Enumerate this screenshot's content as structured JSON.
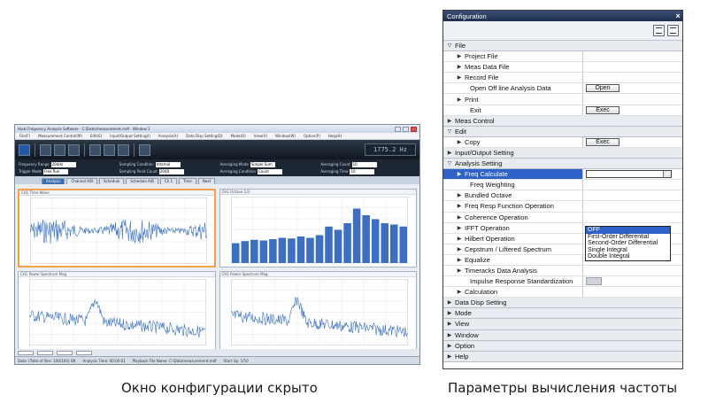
{
  "left_window": {
    "title": "Hioki Frequency Analysis Software - C:\\Data\\measurement.mdf - Window 1",
    "menu": [
      "File(F)",
      "Measurement Control(M)",
      "Edit(E)",
      "Input/Output Setting(I)",
      "Analysis(A)",
      "Data Disp Setting(D)",
      "Mode(O)",
      "View(V)",
      "Window(W)",
      "Option(P)",
      "Help(H)"
    ],
    "lcd": "1775.2 Hz",
    "params": [
      {
        "label": "Frequency Range",
        "value": "20kHz"
      },
      {
        "label": "Sampling Condition",
        "value": "Internal"
      },
      {
        "label": "Averaging Mode",
        "value": "Simple Sum"
      },
      {
        "label": "Averaging Count",
        "value": "10"
      },
      {
        "label": "Trigger Mode",
        "value": "Free Run"
      },
      {
        "label": "Sampling Point Count",
        "value": "2048"
      },
      {
        "label": "Averaging Condition",
        "value": "Count"
      },
      {
        "label": "Averaging Time",
        "value": "10"
      }
    ],
    "tabs": [
      "Analysis",
      "Channel A/B",
      "Schedule",
      "Schedule A/B",
      "Ch 1",
      "Time",
      "Next"
    ],
    "plots": [
      {
        "title": "CH1 Time Wave",
        "footer": "X: 0.000s  Y: 0.0000 mV"
      },
      {
        "title": "CH1 Octave 1/3",
        "footer": "X: 20.000 kHz  Y: 40.0000 dB"
      },
      {
        "title": "CH1 Power Spectrum Mag",
        "footer": "X: 0.000kHz  Y: 10.0000 dBV"
      },
      {
        "title": "CH1 Power Spectrum Mag",
        "footer": "X: 0.000kHz  Y: 10.0000 dBV"
      }
    ],
    "status": [
      "Data: (Total of files: 100/100)  OK",
      "Analysis Time: 00:00:01",
      "Playback File Name: C:\\Data\\measurement.mdf",
      "Start Up: 1/10"
    ]
  },
  "config": {
    "title": "Configuration",
    "close": "×",
    "rows": [
      {
        "type": "cat",
        "arrow": "▽",
        "label": "File",
        "indent": 0
      },
      {
        "type": "item",
        "arrow": "▶",
        "label": "Project File",
        "indent": 1
      },
      {
        "type": "item",
        "arrow": "▶",
        "label": "Meas Data File",
        "indent": 1
      },
      {
        "type": "item",
        "arrow": "▶",
        "label": "Record File",
        "indent": 1
      },
      {
        "type": "item",
        "arrow": "",
        "label": "Open Off line Analysis Data",
        "indent": 1,
        "button": "Open"
      },
      {
        "type": "item",
        "arrow": "▶",
        "label": "Print",
        "indent": 1
      },
      {
        "type": "item",
        "arrow": "",
        "label": "Exit",
        "indent": 1,
        "button": "Exec"
      },
      {
        "type": "cat",
        "arrow": "▶",
        "label": "Meas Control",
        "indent": 0
      },
      {
        "type": "cat",
        "arrow": "▽",
        "label": "Edit",
        "indent": 0
      },
      {
        "type": "item",
        "arrow": "▶",
        "label": "Copy",
        "indent": 1,
        "button": "Exec"
      },
      {
        "type": "cat",
        "arrow": "▶",
        "label": "Input/Output Setting",
        "indent": 0
      },
      {
        "type": "cat",
        "arrow": "▽",
        "label": "Analysis Setting",
        "indent": 0
      },
      {
        "type": "hl",
        "arrow": "▶",
        "label": "Freq Calculate",
        "indent": 1,
        "dropdown": "OFF"
      },
      {
        "type": "item",
        "arrow": "",
        "label": "Freq Weighting",
        "indent": 1
      },
      {
        "type": "item",
        "arrow": "▶",
        "label": "Bundled Octave",
        "indent": 1
      },
      {
        "type": "item",
        "arrow": "▶",
        "label": "Freq Resp Function Operation",
        "indent": 1
      },
      {
        "type": "item",
        "arrow": "▶",
        "label": "Coherence Operation",
        "indent": 1
      },
      {
        "type": "item",
        "arrow": "▶",
        "label": "IFFT Operation",
        "indent": 1
      },
      {
        "type": "item",
        "arrow": "▶",
        "label": "Hilbert Operation",
        "indent": 1
      },
      {
        "type": "item",
        "arrow": "▶",
        "label": "Cepstrum / Liftered Spectrum",
        "indent": 1
      },
      {
        "type": "item",
        "arrow": "▶",
        "label": "Equalize",
        "indent": 1
      },
      {
        "type": "item",
        "arrow": "▶",
        "label": "Timeracks Data Analysis",
        "indent": 1
      },
      {
        "type": "item",
        "arrow": "",
        "label": "Impulse Response Standardization",
        "indent": 1,
        "small": true
      },
      {
        "type": "item",
        "arrow": "▶",
        "label": "Calculation",
        "indent": 1
      },
      {
        "type": "cat",
        "arrow": "▶",
        "label": "Data Disp Setting",
        "indent": 0
      },
      {
        "type": "cat",
        "arrow": "▶",
        "label": "Mode",
        "indent": 0
      },
      {
        "type": "cat",
        "arrow": "▶",
        "label": "View",
        "indent": 0
      },
      {
        "type": "cat",
        "arrow": "▶",
        "label": "Window",
        "indent": 0
      },
      {
        "type": "cat",
        "arrow": "▶",
        "label": "Option",
        "indent": 0
      },
      {
        "type": "cat",
        "arrow": "▶",
        "label": "Help",
        "indent": 0
      }
    ],
    "dropdown_options": [
      "OFF",
      "First-Order Differential",
      "Second-Order Differential",
      "Single Integral",
      "Double Integral"
    ],
    "dropdown_selected": 0
  },
  "captions": {
    "left": "Окно конфигурации скрыто",
    "right": "Параметры вычисления частоты"
  }
}
